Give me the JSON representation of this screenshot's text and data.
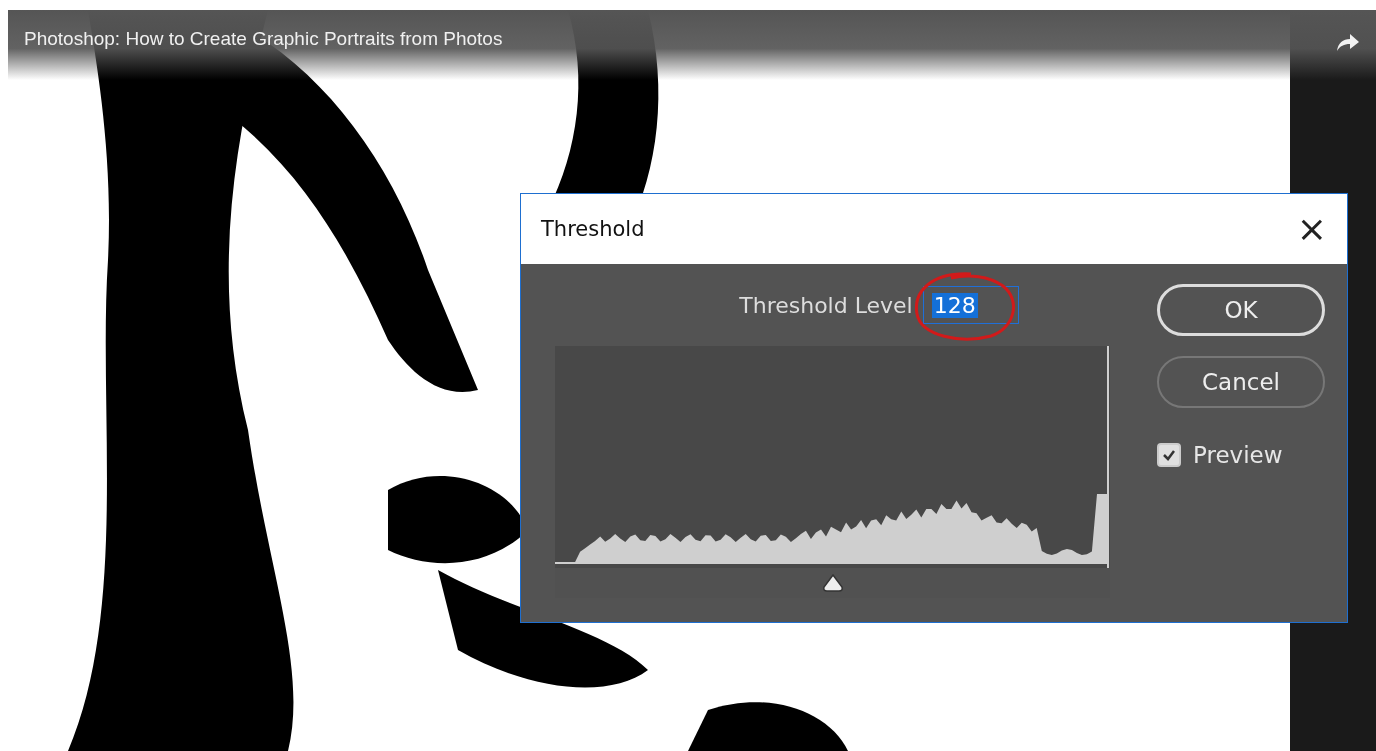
{
  "video": {
    "title": "Photoshop: How to Create Graphic Portraits from Photos"
  },
  "dialog": {
    "title": "Threshold",
    "close": "×",
    "level_field": {
      "label": "Threshold Level",
      "value": "128",
      "selected": true
    },
    "slider": {
      "level": 0.5
    },
    "buttons": [
      {
        "label": "OK",
        "default": true
      },
      {
        "label": "Cancel",
        "default": false
      }
    ],
    "preview": {
      "label": "Preview",
      "checked": true
    }
  }
}
